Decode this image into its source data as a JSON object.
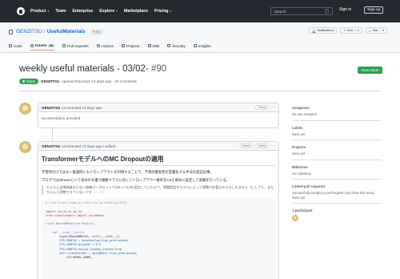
{
  "topnav": {
    "items": [
      "Product",
      "Team",
      "Enterprise",
      "Explore",
      "Marketplace",
      "Pricing"
    ],
    "search_placeholder": "Search",
    "slash_key": "/",
    "signin": "Sign in",
    "signup": "Sign up"
  },
  "repo": {
    "owner": "GENZITSU",
    "slash": "/",
    "name": "UsefulMaterials",
    "visibility": "Public",
    "notifications": "Notifications",
    "fork_label": "Fork",
    "fork_count": "0",
    "star_label": "Star",
    "star_count": "0"
  },
  "tabs": [
    {
      "label": "Code",
      "count": ""
    },
    {
      "label": "Issues",
      "count": "95"
    },
    {
      "label": "Pull requests",
      "count": ""
    },
    {
      "label": "Actions",
      "count": ""
    },
    {
      "label": "Projects",
      "count": ""
    },
    {
      "label": "Wiki",
      "count": ""
    },
    {
      "label": "Security",
      "count": ""
    },
    {
      "label": "Insights",
      "count": ""
    }
  ],
  "issue": {
    "title": "weekly useful materials - 03/02-",
    "number": "#90",
    "new_issue": "New issue",
    "state": "Open",
    "author": "GENZITSU",
    "meta": "opened this issue 10 days ago · 26 comments"
  },
  "comments": [
    {
      "author": "GENZITSU",
      "meta": "commented 10 days ago",
      "role": "Owner",
      "body": "No description provided."
    },
    {
      "author": "GENZITSU",
      "meta": "commented 10 days ago • edited",
      "role": "Owner",
      "role2": "Author",
      "heading": "TransformerモデルへのMC Dropoutの適用",
      "para1": "学習時だけではなく推論時にもドロップアウトを利用することで、予測の確実性を定量化する手法の実証記事。",
      "para2": "ブログでは20newsという長めの文書が複数クラスに対してドロップアウト確率を0.5と極めに設定して実験を行っている。",
      "quote": "もともと出現頻度の少ない訓練データセットでは0.1〜0.2を設定していたので、問題設定やモデルによって調整が必要なのかもしれません（にしても、まだちゃんと調整できていないです・・・）",
      "code": [
        "# from https://www.ai-shift.co.jp/techblog/2510",
        "",
        "import torch.nn as nn",
        "from transformers import AutoModel",
        "",
        "class BaseSNModel(nn.Module):",
        "",
        "    def __init__(self):",
        "        super(BaseSNModel, self).__init__()",
        "        CFG.CONFIG = AutoConfig.from_pretrained(",
        "        CFG.CONFIG.dropout = 0.5",
        "        CFG.CONFIG.output_hidden_states=True",
        "        self.transformer = AutoModel.from_pretrained(",
        "            CFG.MODEL_NAME,"
      ]
    }
  ],
  "sidebar": {
    "assignees_h": "Assignees",
    "assignees_v": "No one assigned",
    "labels_h": "Labels",
    "labels_v": "None yet",
    "projects_h": "Projects",
    "projects_v": "None yet",
    "milestone_h": "Milestone",
    "milestone_v": "No milestone",
    "linked_h": "Linked pull requests",
    "linked_v": "Successfully merging a pull request may close this issue.",
    "linked_v2": "None yet",
    "participants_h": "1 participant"
  },
  "colors": {
    "header_bg": "#24292f",
    "open_green": "#2da44e",
    "link_blue": "#0969da",
    "active_tab": "#fd8c73"
  }
}
